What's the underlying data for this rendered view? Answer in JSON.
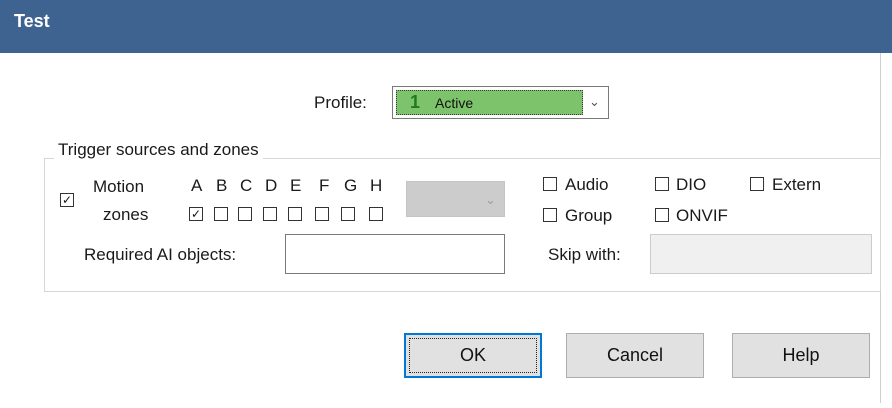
{
  "window": {
    "title": "Test"
  },
  "profile": {
    "label": "Profile:",
    "selected_number": "1",
    "selected_name": "Active",
    "selected_color": "#7cc36b",
    "dropdown_icon": "chevron-down-icon"
  },
  "trigger_group": {
    "title": "Trigger sources and zones",
    "motion": {
      "label_line1": "Motion",
      "label_line2": "zones",
      "checked": true
    },
    "zones": [
      {
        "letter": "A",
        "checked": true
      },
      {
        "letter": "B",
        "checked": false
      },
      {
        "letter": "C",
        "checked": false
      },
      {
        "letter": "D",
        "checked": false
      },
      {
        "letter": "E",
        "checked": false
      },
      {
        "letter": "F",
        "checked": false
      },
      {
        "letter": "G",
        "checked": false
      },
      {
        "letter": "H",
        "checked": false
      }
    ],
    "sources": [
      {
        "label": "Audio",
        "checked": false
      },
      {
        "label": "DIO",
        "checked": false
      },
      {
        "label": "Extern",
        "checked": false
      },
      {
        "label": "Group",
        "checked": false
      },
      {
        "label": "ONVIF",
        "checked": false
      }
    ],
    "required_ai": {
      "label": "Required AI objects:",
      "value": ""
    },
    "skip_with": {
      "label": "Skip with:",
      "value": ""
    }
  },
  "buttons": {
    "ok": "OK",
    "cancel": "Cancel",
    "help": "Help"
  },
  "colors": {
    "titlebar": "#3f6390",
    "default_button_border": "#0078d7"
  }
}
